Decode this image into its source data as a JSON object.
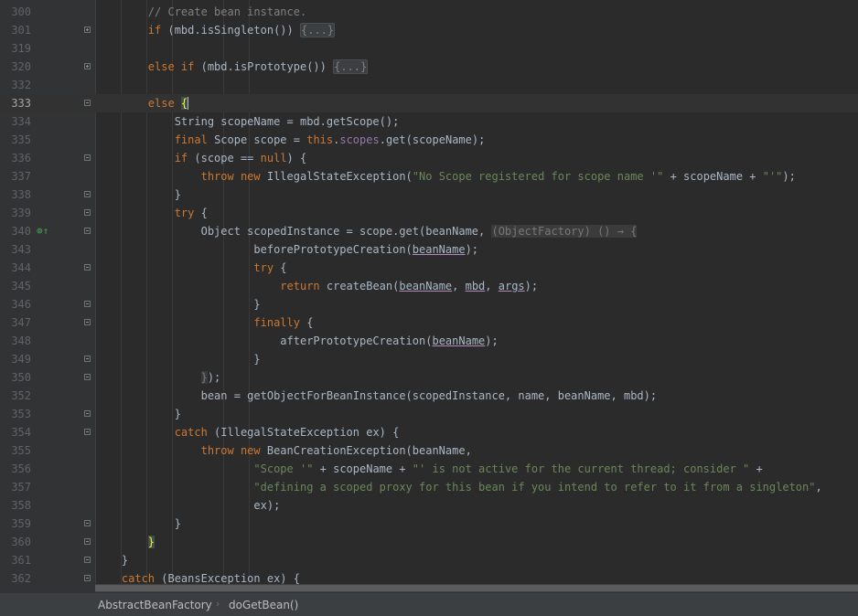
{
  "editor": {
    "lines": [
      {
        "num": "300",
        "fold": "",
        "marker": "",
        "tokens": [
          [
            "t",
            "        "
          ],
          [
            "cmt",
            "// Create bean instance."
          ]
        ]
      },
      {
        "num": "301",
        "fold": "collapsed",
        "marker": "",
        "tokens": [
          [
            "t",
            "        "
          ],
          [
            "kw",
            "if"
          ],
          [
            "t",
            " (mbd.isSingleton()) "
          ],
          [
            "folded",
            "{...}"
          ]
        ]
      },
      {
        "num": "319",
        "fold": "",
        "marker": "",
        "tokens": []
      },
      {
        "num": "320",
        "fold": "collapsed",
        "marker": "",
        "tokens": [
          [
            "t",
            "        "
          ],
          [
            "kw",
            "else if"
          ],
          [
            "t",
            " (mbd.isPrototype()) "
          ],
          [
            "folded",
            "{...}"
          ]
        ]
      },
      {
        "num": "332",
        "fold": "",
        "marker": "",
        "tokens": []
      },
      {
        "num": "333",
        "fold": "open",
        "marker": "",
        "current": true,
        "tokens": [
          [
            "t",
            "        "
          ],
          [
            "kw",
            "else "
          ],
          [
            "brace",
            "{"
          ]
        ]
      },
      {
        "num": "334",
        "fold": "",
        "marker": "",
        "tokens": [
          [
            "t",
            "            String scopeName = mbd.getScope();"
          ]
        ]
      },
      {
        "num": "335",
        "fold": "",
        "marker": "",
        "tokens": [
          [
            "t",
            "            "
          ],
          [
            "kw",
            "final "
          ],
          [
            "t",
            "Scope scope = "
          ],
          [
            "kw",
            "this"
          ],
          [
            "t",
            "."
          ],
          [
            "fld",
            "scopes"
          ],
          [
            "t",
            ".get(scopeName);"
          ]
        ]
      },
      {
        "num": "336",
        "fold": "open",
        "marker": "",
        "tokens": [
          [
            "t",
            "            "
          ],
          [
            "kw",
            "if"
          ],
          [
            "t",
            " (scope == "
          ],
          [
            "kw",
            "null"
          ],
          [
            "t",
            ") {"
          ]
        ]
      },
      {
        "num": "337",
        "fold": "",
        "marker": "",
        "tokens": [
          [
            "t",
            "                "
          ],
          [
            "kw",
            "throw new "
          ],
          [
            "t",
            "IllegalStateException("
          ],
          [
            "str",
            "\"No Scope registered for scope name '\""
          ],
          [
            "t",
            " + scopeName + "
          ],
          [
            "str",
            "\"'\""
          ],
          [
            "t",
            ");"
          ]
        ]
      },
      {
        "num": "338",
        "fold": "open",
        "marker": "",
        "tokens": [
          [
            "t",
            "            }"
          ]
        ]
      },
      {
        "num": "339",
        "fold": "open",
        "marker": "",
        "tokens": [
          [
            "t",
            "            "
          ],
          [
            "kw",
            "try"
          ],
          [
            "t",
            " {"
          ]
        ]
      },
      {
        "num": "340",
        "fold": "open",
        "marker": "⊚↑",
        "tokens": [
          [
            "t",
            "                Object scopedInstance = scope.get(beanName, "
          ],
          [
            "hint",
            "(ObjectFactory) () → {"
          ]
        ]
      },
      {
        "num": "343",
        "fold": "",
        "marker": "",
        "tokens": [
          [
            "t",
            "                        beforePrototypeCreation("
          ],
          [
            "ul",
            "beanName"
          ],
          [
            "t",
            ");"
          ]
        ]
      },
      {
        "num": "344",
        "fold": "open",
        "marker": "",
        "tokens": [
          [
            "t",
            "                        "
          ],
          [
            "kw",
            "try"
          ],
          [
            "t",
            " {"
          ]
        ]
      },
      {
        "num": "345",
        "fold": "",
        "marker": "",
        "tokens": [
          [
            "t",
            "                            "
          ],
          [
            "kw",
            "return "
          ],
          [
            "t",
            "createBean("
          ],
          [
            "ul",
            "beanName"
          ],
          [
            "t",
            ", "
          ],
          [
            "ul",
            "mbd"
          ],
          [
            "t",
            ", "
          ],
          [
            "ul",
            "args"
          ],
          [
            "t",
            ");"
          ]
        ]
      },
      {
        "num": "346",
        "fold": "open",
        "marker": "",
        "tokens": [
          [
            "t",
            "                        }"
          ]
        ]
      },
      {
        "num": "347",
        "fold": "open",
        "marker": "",
        "tokens": [
          [
            "t",
            "                        "
          ],
          [
            "kw",
            "finally"
          ],
          [
            "t",
            " {"
          ]
        ]
      },
      {
        "num": "348",
        "fold": "",
        "marker": "",
        "tokens": [
          [
            "t",
            "                            afterPrototypeCreation("
          ],
          [
            "ul",
            "beanName"
          ],
          [
            "t",
            ");"
          ]
        ]
      },
      {
        "num": "349",
        "fold": "open",
        "marker": "",
        "tokens": [
          [
            "t",
            "                        }"
          ]
        ]
      },
      {
        "num": "350",
        "fold": "open",
        "marker": "",
        "tokens": [
          [
            "t",
            "                "
          ],
          [
            "hint",
            "}"
          ],
          [
            "t",
            ");"
          ]
        ]
      },
      {
        "num": "352",
        "fold": "",
        "marker": "",
        "tokens": [
          [
            "t",
            "                bean = getObjectForBeanInstance(scopedInstance, name, beanName, mbd);"
          ]
        ]
      },
      {
        "num": "353",
        "fold": "open",
        "marker": "",
        "tokens": [
          [
            "t",
            "            }"
          ]
        ]
      },
      {
        "num": "354",
        "fold": "open",
        "marker": "",
        "tokens": [
          [
            "t",
            "            "
          ],
          [
            "kw",
            "catch"
          ],
          [
            "t",
            " (IllegalStateException ex) {"
          ]
        ]
      },
      {
        "num": "355",
        "fold": "",
        "marker": "",
        "tokens": [
          [
            "t",
            "                "
          ],
          [
            "kw",
            "throw new "
          ],
          [
            "t",
            "BeanCreationException(beanName,"
          ]
        ]
      },
      {
        "num": "356",
        "fold": "",
        "marker": "",
        "tokens": [
          [
            "t",
            "                        "
          ],
          [
            "str",
            "\"Scope '\""
          ],
          [
            "t",
            " + scopeName + "
          ],
          [
            "str",
            "\"' is not active for the current thread; consider \""
          ],
          [
            "t",
            " +"
          ]
        ]
      },
      {
        "num": "357",
        "fold": "",
        "marker": "",
        "tokens": [
          [
            "t",
            "                        "
          ],
          [
            "str",
            "\"defining a scoped proxy for this bean if you intend to refer to it from a singleton\""
          ],
          [
            "t",
            ","
          ]
        ]
      },
      {
        "num": "358",
        "fold": "",
        "marker": "",
        "tokens": [
          [
            "t",
            "                        ex);"
          ]
        ]
      },
      {
        "num": "359",
        "fold": "open",
        "marker": "",
        "tokens": [
          [
            "t",
            "            }"
          ]
        ]
      },
      {
        "num": "360",
        "fold": "open",
        "marker": "",
        "tokens": [
          [
            "t",
            "        "
          ],
          [
            "brace",
            "}"
          ]
        ]
      },
      {
        "num": "361",
        "fold": "open",
        "marker": "",
        "tokens": [
          [
            "t",
            "    }"
          ]
        ]
      },
      {
        "num": "362",
        "fold": "open",
        "marker": "",
        "tokens": [
          [
            "t",
            "    "
          ],
          [
            "kw",
            "catch"
          ],
          [
            "t",
            " (BeansException ex) {"
          ]
        ]
      }
    ]
  },
  "breadcrumb": {
    "class_name": "AbstractBeanFactory",
    "separator": "›",
    "method_name": "doGetBean()"
  }
}
